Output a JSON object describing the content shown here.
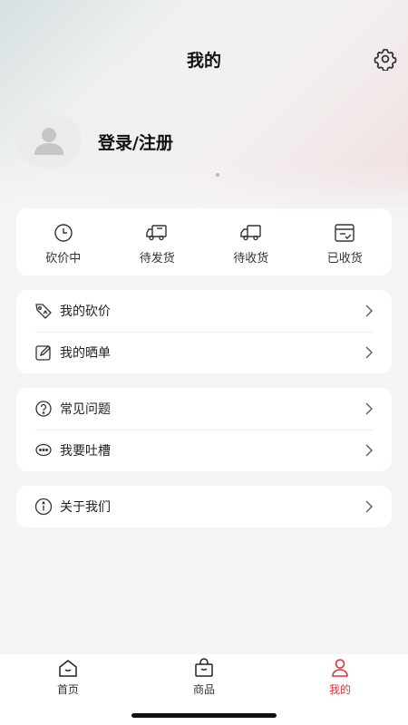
{
  "header": {
    "title": "我的"
  },
  "profile": {
    "login_label": "登录/注册"
  },
  "orders": [
    {
      "label": "砍价中",
      "icon": "clock-icon"
    },
    {
      "label": "待发货",
      "icon": "truck-box-icon"
    },
    {
      "label": "待收货",
      "icon": "truck-icon"
    },
    {
      "label": "已收货",
      "icon": "received-box-icon"
    }
  ],
  "menu": {
    "group1": [
      {
        "label": "我的砍价",
        "icon": "price-tag-icon"
      },
      {
        "label": "我的晒单",
        "icon": "edit-icon"
      }
    ],
    "group2": [
      {
        "label": "常见问题",
        "icon": "question-icon"
      },
      {
        "label": "我要吐槽",
        "icon": "chat-icon"
      }
    ],
    "group3": [
      {
        "label": "关于我们",
        "icon": "info-icon"
      }
    ]
  },
  "tabbar": {
    "items": [
      {
        "label": "首页",
        "icon": "home-icon"
      },
      {
        "label": "商品",
        "icon": "bag-icon"
      },
      {
        "label": "我的",
        "icon": "user-icon"
      }
    ],
    "active": "我的",
    "active_color": "#e0303a"
  }
}
